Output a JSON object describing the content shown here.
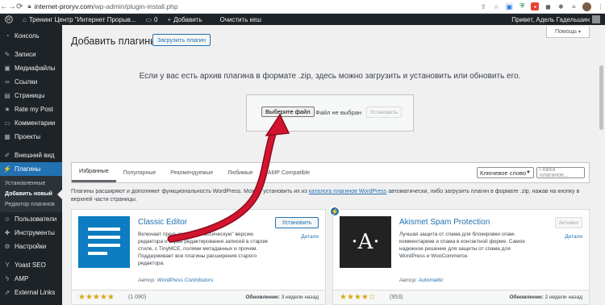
{
  "browser": {
    "url_host": "internet-proryv.com",
    "url_path": "/wp-admin/plugin-install.php"
  },
  "adminbar": {
    "site_name": "Тренинг Центр \"Интернет Прорыв...",
    "comments_count": "0",
    "add_label": "Добавить",
    "clear_cache": "Очистить кеш",
    "greeting": "Привет, Адель Гадельшин"
  },
  "sidebar": {
    "items": [
      {
        "label": "Консоль",
        "icon": "dashboard-icon"
      },
      {
        "label": "Записи",
        "icon": "pin-icon"
      },
      {
        "label": "Медиафайлы",
        "icon": "media-icon"
      },
      {
        "label": "Ссылки",
        "icon": "link-icon"
      },
      {
        "label": "Страницы",
        "icon": "pages-icon"
      },
      {
        "label": "Rate my Post",
        "icon": "star-icon"
      },
      {
        "label": "Комментарии",
        "icon": "comments-icon"
      },
      {
        "label": "Проекты",
        "icon": "portfolio-icon"
      },
      {
        "label": "Внешний вид",
        "icon": "appearance-icon"
      },
      {
        "label": "Плагины",
        "icon": "plugins-icon"
      },
      {
        "label": "Пользователи",
        "icon": "users-icon"
      },
      {
        "label": "Инструменты",
        "icon": "tools-icon"
      },
      {
        "label": "Настройки",
        "icon": "settings-icon"
      },
      {
        "label": "Yoast SEO",
        "icon": "yoast-icon"
      },
      {
        "label": "AMP",
        "icon": "amp-icon"
      },
      {
        "label": "External Links",
        "icon": "external-links-icon"
      }
    ],
    "submenu": [
      "Установленные",
      "Добавить новый",
      "Редактор плагинов"
    ]
  },
  "page": {
    "title": "Добавить плагины",
    "upload_button": "Загрузить плагин",
    "help": "Помощь"
  },
  "upload": {
    "instructions": "Если у вас есть архив плагина в формате .zip, здесь можно загрузить и установить или обновить его.",
    "choose_file": "Выберите файл",
    "no_file": "Файл не выбран",
    "install": "Установить"
  },
  "filter": {
    "tabs": [
      "Избранные",
      "Популярные",
      "Рекомендуемые",
      "Любимые",
      "AMP Compatible"
    ],
    "select_value": "Ключевое слово",
    "search_placeholder": "Поиск плагинов..."
  },
  "description": {
    "part1": "Плагины расширяют и дополняют функциональность WordPress. Можно установить их из ",
    "link": "каталога плагинов WordPress",
    "part2": " автоматически, либо загрузить плагин в формате .zip, нажав на кнопку в верхней части страницы."
  },
  "plugins": [
    {
      "name": "Classic Editor",
      "description": "Включает предыдущую \"классическую\" версию редактора и экран редактирования записей в старом стиле, с TinyMCE, полями метаданных и прочим. Поддерживает все плагины расширения старого редактора.",
      "author_prefix": "Автор:",
      "author": "WordPress Contributors",
      "action": "Установить",
      "details": "Детали",
      "stars": "★★★★★",
      "rating_count": "(1 090)",
      "updated_label": "Обновление:",
      "updated_value": "3 недели назад"
    },
    {
      "name": "Akismet Spam Protection",
      "description": "Лучшая защита от спама для блокировки спам-комментариев и спама в контактной форме. Самое надежное решение для защиты от спама для WordPress и WooCommerce.",
      "author_prefix": "Автор:",
      "author": "Automattic",
      "action": "Активно",
      "details": "Детали",
      "stars": "★★★★☆",
      "rating_count": "(953)",
      "updated_label": "Обновление:",
      "updated_value": "2 недели назад"
    }
  ],
  "colors": {
    "admin_dark": "#1d2327",
    "accent": "#2271b1",
    "arrow": "#c8102e",
    "star": "#dba617"
  }
}
